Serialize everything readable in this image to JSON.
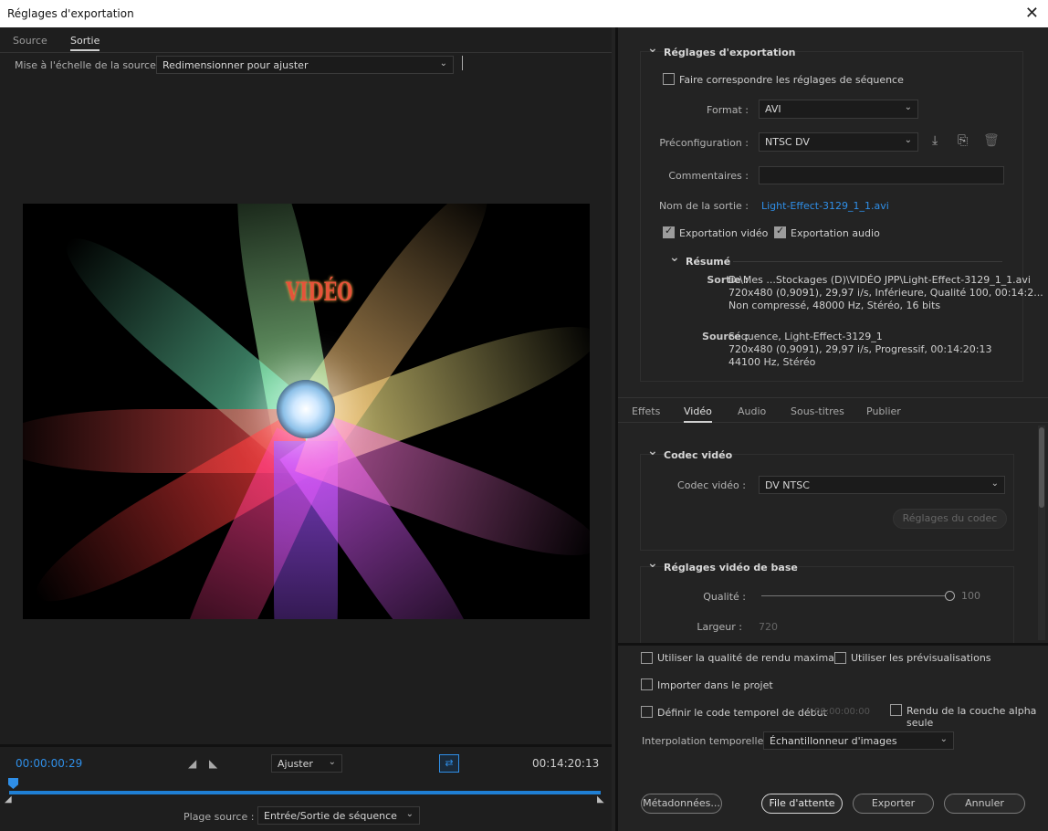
{
  "window": {
    "title": "Réglages d'exportation",
    "close_glyph": "✕"
  },
  "left": {
    "tabs": [
      "Source",
      "Sortie"
    ],
    "scale_label": "Mise à l'échelle de la source :",
    "scale_value": "Redimensionner pour ajuster",
    "preview_text": "VIDÉO",
    "timecode_current": "00:00:00:29",
    "timecode_end": "00:14:20:13",
    "zoom_value": "Ajuster",
    "range_label": "Plage source :",
    "range_value": "Entrée/Sortie de séquence"
  },
  "export": {
    "header": "Réglages d'exportation",
    "match_seq": "Faire correspondre les réglages de séquence",
    "format_label": "Format :",
    "format_value": "AVI",
    "preset_label": "Préconfiguration :",
    "preset_value": "NTSC DV",
    "comments_label": "Commentaires :",
    "output_label": "Nom de la sortie :",
    "output_value": "Light-Effect-3129_1_1.avi",
    "video_export": "Exportation vidéo",
    "audio_export": "Exportation audio",
    "summary_header": "Résumé",
    "sortie_label": "Sortie :",
    "sortie_lines": [
      "D:\\Mes ...Stockages (D)\\VIDÉO JPP\\Light-Effect-3129_1_1.avi",
      "720x480 (0,9091), 29,97 i/s, Inférieure, Qualité  100, 00:14:2...",
      "Non compressé, 48000  Hz, Stéréo, 16 bits"
    ],
    "source_label": "Source :",
    "source_lines": [
      "Séquence, Light-Effect-3129_1",
      "720x480 (0,9091), 29,97  i/s, Progressif, 00:14:20:13",
      "44100 Hz, Stéréo"
    ]
  },
  "tabs2": [
    "Effets",
    "Vidéo",
    "Audio",
    "Sous-titres",
    "Publier"
  ],
  "codec": {
    "header": "Codec vidéo",
    "label": "Codec vidéo :",
    "value": "DV NTSC",
    "settings_btn": "Réglages du codec"
  },
  "basic": {
    "header": "Réglages vidéo de base",
    "quality_label": "Qualité :",
    "quality_value": "100",
    "width_label": "Largeur :",
    "width_value": "720"
  },
  "bottom": {
    "max_quality": "Utiliser la qualité de rendu maximale",
    "use_previews": "Utiliser les prévisualisations",
    "import_project": "Importer dans le projet",
    "set_timecode": "Définir le code temporel de début",
    "timecode_value": "00:00:00:00",
    "alpha_only": "Rendu de la couche alpha seule",
    "interp_label": "Interpolation temporelle :",
    "interp_value": "Échantillonneur d'images",
    "metadata_btn": "Métadonnées...",
    "queue_btn": "File d'attente",
    "export_btn": "Exporter",
    "cancel_btn": "Annuler"
  },
  "colors": {
    "accent": "#2f8fe8",
    "timeline": "#1f7fd4"
  }
}
